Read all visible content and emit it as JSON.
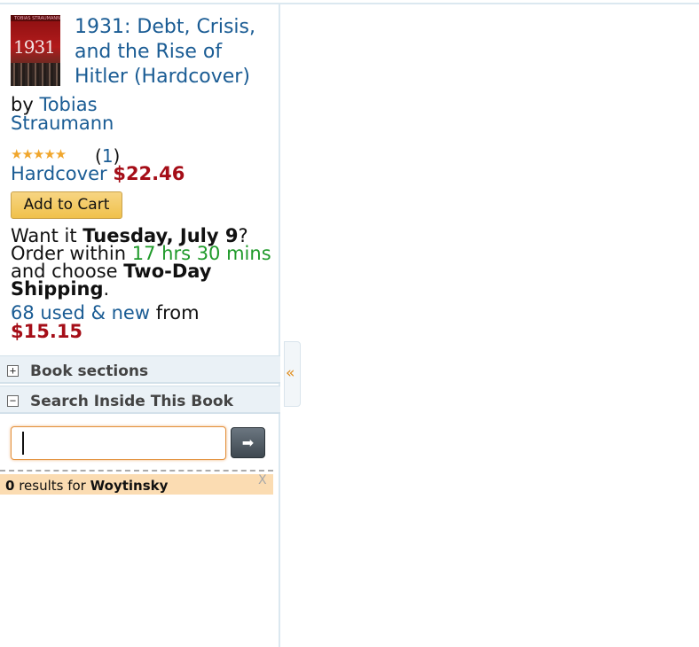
{
  "book": {
    "title": "1931: Debt, Crisis, and the Rise of Hitler (Hardcover)",
    "cover_year": "1931",
    "cover_top_text": "TOBIAS STRAUMANN",
    "by_label": "by",
    "author_first": "Tobias",
    "author_last": "Straumann",
    "stars_glyphs": "★★★★★",
    "review_count_open": "(",
    "review_count": "1",
    "review_count_close": ")",
    "format": "Hardcover",
    "price": "$22.46"
  },
  "cart": {
    "add_label": "Add to Cart"
  },
  "delivery": {
    "part1": "Want it ",
    "date": "Tuesday, July 9",
    "part2": "? Order within ",
    "countdown": "17 hrs 30 mins",
    "part3": " and choose ",
    "shipping": "Two-Day Shipping",
    "part4": "."
  },
  "offers": {
    "used_new": "68 used & new",
    "from_label": " from",
    "price": "$15.15"
  },
  "sections": [
    {
      "icon": "+",
      "label": "Book sections"
    },
    {
      "icon": "−",
      "label": "Search Inside This Book"
    }
  ],
  "search": {
    "value": "",
    "go_glyph": "➡"
  },
  "results": {
    "count": "0",
    "mid": " results for ",
    "query": "Woytinsky",
    "close_glyph": "X"
  },
  "collapse_glyph": "«",
  "colors": {
    "link": "#1a5c94",
    "price": "#a50e18",
    "countdown": "#1f9a2a",
    "cart_button": "#f0c14b",
    "result_bar": "#fbdcb2"
  }
}
